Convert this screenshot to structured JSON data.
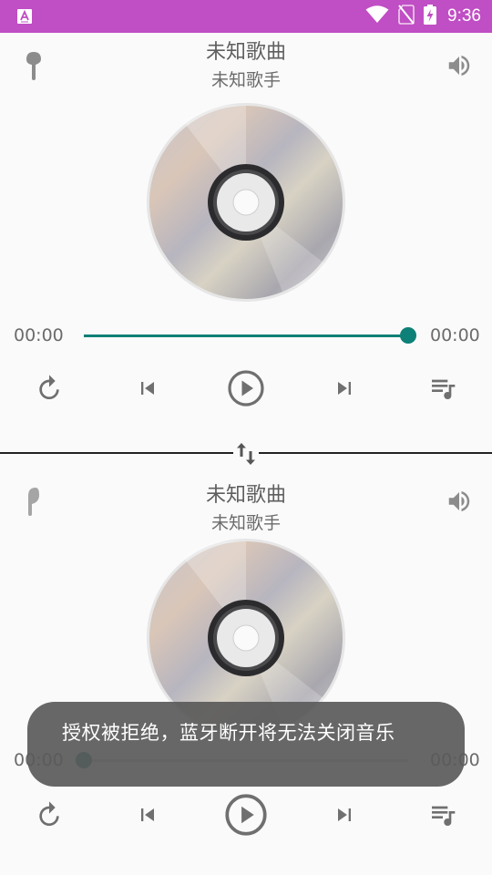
{
  "status_bar": {
    "time": "9:36",
    "color": "#c04ec4",
    "icons": [
      "app-a-icon",
      "wifi-icon",
      "no-sim-icon",
      "battery-charging-icon"
    ]
  },
  "player_top": {
    "title": "未知歌曲",
    "artist": "未知歌手",
    "current_time": "00:00",
    "total_time": "00:00",
    "progress": 1.0,
    "accent": "#0d8077"
  },
  "player_bottom": {
    "title": "未知歌曲",
    "artist": "未知歌手",
    "current_time": "00:00",
    "total_time": "00:00",
    "progress": 0.0
  },
  "toast": {
    "message": "授权被拒绝，蓝牙断开将无法关闭音乐"
  }
}
